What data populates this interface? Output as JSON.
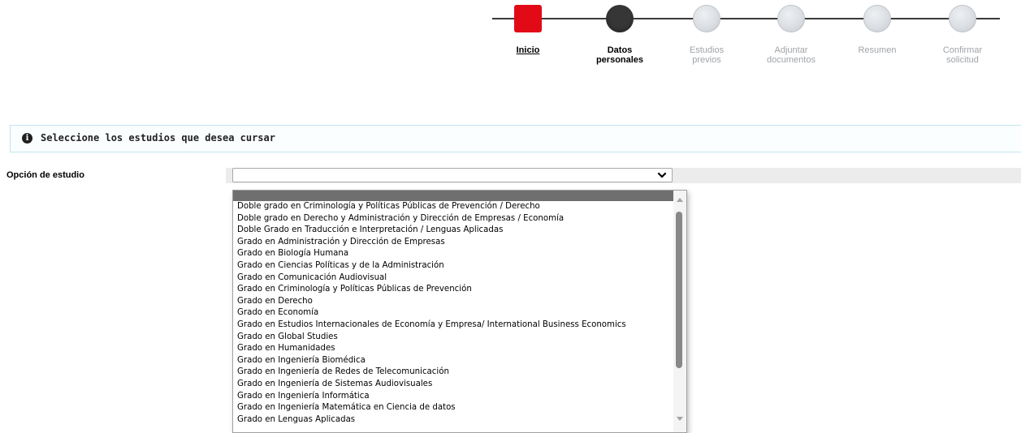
{
  "stepper": {
    "steps": [
      {
        "label_line1": "Inicio",
        "label_line2": "",
        "state": "current"
      },
      {
        "label_line1": "Datos",
        "label_line2": "personales",
        "state": "done"
      },
      {
        "label_line1": "Estudios",
        "label_line2": "previos",
        "state": "pending"
      },
      {
        "label_line1": "Adjuntar",
        "label_line2": "documentos",
        "state": "pending"
      },
      {
        "label_line1": "Resumen",
        "label_line2": "",
        "state": "pending"
      },
      {
        "label_line1": "Confirmar",
        "label_line2": "solicitud",
        "state": "pending"
      }
    ],
    "colors": {
      "active": "#e30a17",
      "done": "#363636",
      "pending": "#d9dde2",
      "line": "#3a3a3a"
    }
  },
  "info": {
    "icon": "info-circle-icon",
    "message": "Seleccione los estudios que desea cursar"
  },
  "form": {
    "study_option_label": "Opción de estudio",
    "select_value": "",
    "chevron_icon": "chevron-down-icon"
  },
  "dropdown": {
    "options": [
      "",
      "Doble grado en Criminología y Políticas Públicas de Prevención / Derecho",
      "Doble grado en Derecho y Administración y Dirección de Empresas / Economía",
      "Doble Grado en Traducción e Interpretación / Lenguas Aplicadas",
      "Grado en Administración y Dirección de Empresas",
      "Grado en Biología Humana",
      "Grado en Ciencias Políticas y de la Administración",
      "Grado en Comunicación Audiovisual",
      "Grado en Criminología y Políticas Públicas de Prevención",
      "Grado en Derecho",
      "Grado en Economía",
      "Grado en Estudios Internacionales de Economía y Empresa/ International Business Economics",
      "Grado en Global Studies",
      "Grado en Humanidades",
      "Grado en Ingeniería Biomédica",
      "Grado en Ingeniería de Redes de Telecomunicación",
      "Grado en Ingeniería de Sistemas Audiovisuales",
      "Grado en Ingeniería Informática",
      "Grado en Ingeniería Matemática en Ciencia de datos",
      "Grado en Lenguas Aplicadas"
    ],
    "selected_index": 0
  }
}
